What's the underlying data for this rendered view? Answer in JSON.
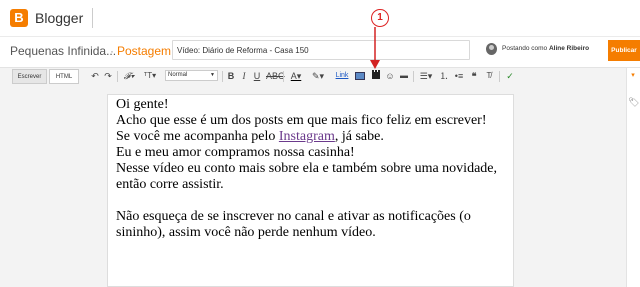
{
  "app": {
    "name": "Blogger"
  },
  "post": {
    "blog_name": "Pequenas Infinida...",
    "separator": "·",
    "section": "Postagem",
    "title_value": "Vídeo: Diário de Reforma - Casa 150",
    "posting_label": "Postando como",
    "author": "Aline Ribeiro",
    "publish_label": "Publicar"
  },
  "toolbar": {
    "mode_compose": "Escrever",
    "mode_html": "HTML",
    "format_value": "Normal",
    "link_label": "Link"
  },
  "annotation": {
    "number": "1",
    "color": "#d22222"
  },
  "editor": {
    "line1": "Oi gente!",
    "line2": "Acho que esse é um dos posts em que mais fico feliz em escrever!",
    "line3_before": "Se você me acompanha pelo ",
    "line3_link": "Instagram",
    "line3_after": ", já sabe.",
    "line4": "Eu e meu amor compramos nossa casinha!",
    "line5": "Nesse vídeo eu conto mais sobre ela e também sobre uma novidade, então corre assistir.",
    "line6": "Não esqueça de se inscrever no canal e ativar as notificações (o sininho), assim você não perde nenhum vídeo."
  },
  "colors": {
    "accent": "#f57d00",
    "link_visited": "#6b3a8c"
  }
}
